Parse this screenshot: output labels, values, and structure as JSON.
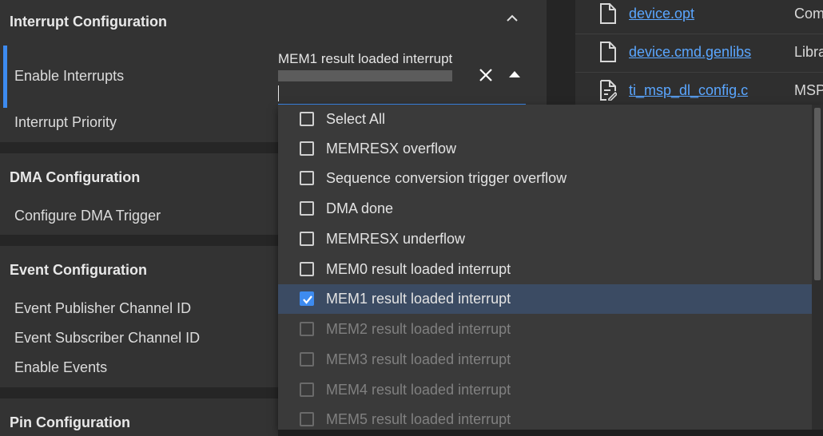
{
  "sections": {
    "interrupt": {
      "title": "Interrupt Configuration",
      "rows": [
        "Enable Interrupts",
        "Interrupt Priority"
      ]
    },
    "dma": {
      "title": "DMA Configuration",
      "rows": [
        "Configure DMA Trigger"
      ]
    },
    "event": {
      "title": "Event Configuration",
      "rows": [
        "Event Publisher Channel ID",
        "Event Subscriber Channel ID",
        "Enable Events"
      ]
    },
    "pin": {
      "title": "Pin Configuration"
    }
  },
  "select": {
    "value": "MEM1 result loaded interrupt",
    "options": [
      {
        "label": "Select All",
        "checked": false,
        "disabled": false
      },
      {
        "label": "MEMRESX overflow",
        "checked": false,
        "disabled": false
      },
      {
        "label": "Sequence conversion trigger overflow",
        "checked": false,
        "disabled": false
      },
      {
        "label": "DMA done",
        "checked": false,
        "disabled": false
      },
      {
        "label": "MEMRESX underflow",
        "checked": false,
        "disabled": false
      },
      {
        "label": "MEM0 result loaded interrupt",
        "checked": false,
        "disabled": false
      },
      {
        "label": "MEM1 result loaded interrupt",
        "checked": true,
        "disabled": false
      },
      {
        "label": "MEM2 result loaded interrupt",
        "checked": false,
        "disabled": true
      },
      {
        "label": "MEM3 result loaded interrupt",
        "checked": false,
        "disabled": true
      },
      {
        "label": "MEM4 result loaded interrupt",
        "checked": false,
        "disabled": true
      },
      {
        "label": "MEM5 result loaded interrupt",
        "checked": false,
        "disabled": true
      }
    ]
  },
  "files": [
    {
      "name": "device.opt",
      "desc": "Com",
      "icon": "file-icon"
    },
    {
      "name": "device.cmd.genlibs",
      "desc": "Libra",
      "icon": "file-icon"
    },
    {
      "name": "ti_msp_dl_config.c",
      "desc": "MSP",
      "icon": "edit-file-icon"
    }
  ],
  "colors": {
    "accent": "#3d8bf0",
    "link": "#5aa6ff",
    "selected_row": "#3b4b63"
  }
}
